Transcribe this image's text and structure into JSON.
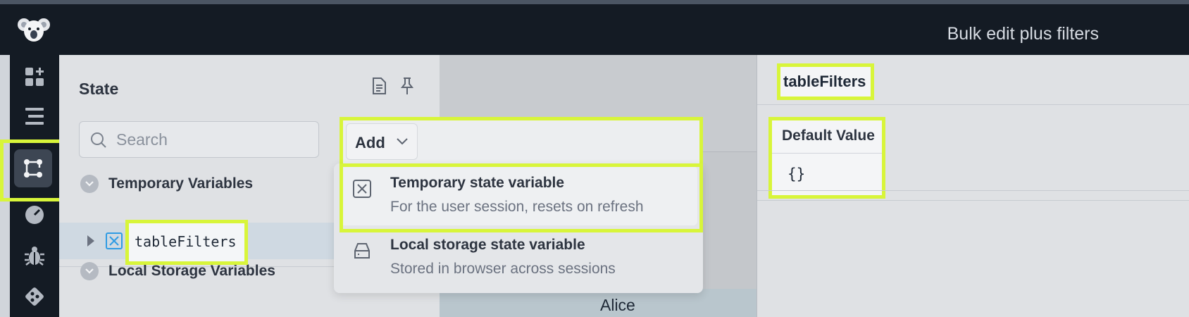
{
  "header": {
    "title": "Bulk edit plus filters"
  },
  "state_panel": {
    "title": "State",
    "search": {
      "placeholder": "Search",
      "value": ""
    },
    "temporary_section": "Temporary Variables",
    "local_section": "Local Storage Variables",
    "variable_name": "tableFilters"
  },
  "add_menu": {
    "button_label": "Add",
    "options": [
      {
        "title": "Temporary state variable",
        "description": "For the user session, resets on refresh"
      },
      {
        "title": "Local storage state variable",
        "description": "Stored in browser across sessions"
      }
    ]
  },
  "table": {
    "cell_text": "Alice"
  },
  "detail_panel": {
    "name": "tableFilters",
    "default_value_label": "Default Value",
    "default_value": "{}"
  },
  "colors": {
    "highlight": "#d8f53a",
    "topbar": "#141b24",
    "accent": "#2f9be3"
  },
  "icons": [
    "koala-logo-icon",
    "add-component-icon",
    "list-icon",
    "state-graph-icon",
    "gauge-icon",
    "bug-icon",
    "git-icon",
    "document-icon",
    "pin-icon",
    "search-icon",
    "chevron-down-icon",
    "variable-icon",
    "storage-icon"
  ]
}
